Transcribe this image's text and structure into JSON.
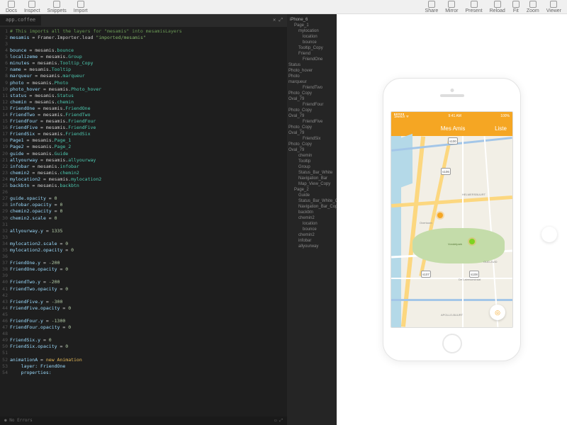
{
  "toolbar": {
    "left": [
      "Docs",
      "Inspect",
      "Snippets",
      "Import"
    ],
    "right": [
      "Share",
      "Mirror",
      "Present",
      "Reload",
      "Fit",
      "Zoom",
      "Viewer"
    ]
  },
  "editor": {
    "tab": "app.coffee",
    "status": "No Errors",
    "lines": [
      {
        "n": 1,
        "t": "cmt",
        "c": "# This imports all the layers for \"mesamis\" into mesamisLayers"
      },
      {
        "n": 2,
        "t": "assign",
        "lhs": "mesamis",
        "rhs": "Framer.Importer.load",
        "str": "\"imported/mesamis\""
      },
      {
        "n": 3,
        "t": "blank"
      },
      {
        "n": 4,
        "t": "assign",
        "lhs": "bounce",
        "rhs": "mesamis.",
        "prop": "bounce"
      },
      {
        "n": 5,
        "t": "assign",
        "lhs": "localizeme",
        "rhs": "mesamis.",
        "prop": "Group"
      },
      {
        "n": 6,
        "t": "assign",
        "lhs": "minutes",
        "rhs": "mesamis.",
        "prop": "Tooltip_Copy"
      },
      {
        "n": 7,
        "t": "assign",
        "lhs": "name",
        "rhs": "mesamis.",
        "prop": "Tooltip"
      },
      {
        "n": 8,
        "t": "assign",
        "lhs": "marqueur",
        "rhs": "mesamis.",
        "prop": "marqueur"
      },
      {
        "n": 9,
        "t": "assign",
        "lhs": "photo",
        "rhs": "mesamis.",
        "prop": "Photo"
      },
      {
        "n": 10,
        "t": "assign",
        "lhs": "photo_hover",
        "rhs": "mesamis.",
        "prop": "Photo_hover"
      },
      {
        "n": 11,
        "t": "assign",
        "lhs": "status",
        "rhs": "mesamis.",
        "prop": "Status"
      },
      {
        "n": 12,
        "t": "assign",
        "lhs": "chemin",
        "rhs": "mesamis.",
        "prop": "chemin"
      },
      {
        "n": 13,
        "t": "assign",
        "lhs": "FriendOne",
        "rhs": "mesamis.",
        "prop": "FriendOne"
      },
      {
        "n": 14,
        "t": "assign",
        "lhs": "FriendTwo",
        "rhs": "mesamis.",
        "prop": "FriendTwo"
      },
      {
        "n": 15,
        "t": "assign",
        "lhs": "FriendFour",
        "rhs": "mesamis.",
        "prop": "FriendFour"
      },
      {
        "n": 16,
        "t": "assign",
        "lhs": "FriendFive",
        "rhs": "mesamis.",
        "prop": "FriendFive"
      },
      {
        "n": 17,
        "t": "assign",
        "lhs": "FriendSix",
        "rhs": "mesamis.",
        "prop": "FriendSix"
      },
      {
        "n": 18,
        "t": "assign",
        "lhs": "Page1",
        "rhs": "mesamis.",
        "prop": "Page_1"
      },
      {
        "n": 19,
        "t": "assign",
        "lhs": "Page2",
        "rhs": "mesamis.",
        "prop": "Page_2"
      },
      {
        "n": 20,
        "t": "assign",
        "lhs": "guide",
        "rhs": "mesamis.",
        "prop": "Guide"
      },
      {
        "n": 21,
        "t": "assign",
        "lhs": "allyourway",
        "rhs": "mesamis.",
        "prop": "allyourway"
      },
      {
        "n": 22,
        "t": "assign",
        "lhs": "infobar",
        "rhs": "mesamis.",
        "prop": "infobar"
      },
      {
        "n": 23,
        "t": "assign",
        "lhs": "chemin2",
        "rhs": "mesamis.",
        "prop": "chemin2"
      },
      {
        "n": 24,
        "t": "assign",
        "lhs": "mylocation2",
        "rhs": "mesamis.",
        "prop": "mylocation2"
      },
      {
        "n": 25,
        "t": "assign",
        "lhs": "backbtn",
        "rhs": "mesamis.",
        "prop": "backbtn"
      },
      {
        "n": 26,
        "t": "blank"
      },
      {
        "n": 27,
        "t": "set",
        "lhs": "guide.opacity",
        "val": "0"
      },
      {
        "n": 28,
        "t": "set",
        "lhs": "infobar.opacity",
        "val": "0"
      },
      {
        "n": 29,
        "t": "set",
        "lhs": "chemin2.opacity",
        "val": "0"
      },
      {
        "n": 30,
        "t": "set",
        "lhs": "chemin2.scale",
        "val": "0"
      },
      {
        "n": 31,
        "t": "blank"
      },
      {
        "n": 32,
        "t": "set",
        "lhs": "allyourway.y",
        "val": "1335"
      },
      {
        "n": 33,
        "t": "blank"
      },
      {
        "n": 34,
        "t": "set",
        "lhs": "mylocation2.scale",
        "val": "0"
      },
      {
        "n": 35,
        "t": "set",
        "lhs": "mylocation2.opacity",
        "val": "0"
      },
      {
        "n": 36,
        "t": "blank"
      },
      {
        "n": 37,
        "t": "set",
        "lhs": "FriendOne.y",
        "val": "-200"
      },
      {
        "n": 38,
        "t": "set",
        "lhs": "FriendOne.opacity",
        "val": "0"
      },
      {
        "n": 39,
        "t": "blank"
      },
      {
        "n": 40,
        "t": "set",
        "lhs": "FriendTwo.y",
        "val": "-200"
      },
      {
        "n": 41,
        "t": "set",
        "lhs": "FriendTwo.opacity",
        "val": "0"
      },
      {
        "n": 42,
        "t": "blank"
      },
      {
        "n": 43,
        "t": "set",
        "lhs": "FriendFive.y",
        "val": "-300"
      },
      {
        "n": 44,
        "t": "set",
        "lhs": "FriendFive.opacity",
        "val": "0"
      },
      {
        "n": 45,
        "t": "blank"
      },
      {
        "n": 46,
        "t": "set",
        "lhs": "FriendFour.y",
        "val": "-1300"
      },
      {
        "n": 47,
        "t": "set",
        "lhs": "FriendFour.opacity",
        "val": "0"
      },
      {
        "n": 48,
        "t": "blank"
      },
      {
        "n": 49,
        "t": "set",
        "lhs": "FriendSix.y",
        "val": "0"
      },
      {
        "n": 50,
        "t": "set",
        "lhs": "FriendSix.opacity",
        "val": "0"
      },
      {
        "n": 51,
        "t": "blank"
      },
      {
        "n": 52,
        "t": "anim",
        "c": "animationA = new Animation"
      },
      {
        "n": 53,
        "t": "animp",
        "c": "    layer: FriendOne"
      },
      {
        "n": 54,
        "t": "animp",
        "c": "    properties:"
      }
    ]
  },
  "layers": {
    "root": "iPhone_6",
    "items": [
      {
        "l": 0,
        "t": "Page_1"
      },
      {
        "l": 1,
        "t": "mylocation"
      },
      {
        "l": 2,
        "t": "location"
      },
      {
        "l": 2,
        "t": "bounce"
      },
      {
        "l": 1,
        "t": "Tooltip_Copy"
      },
      {
        "l": 1,
        "t": "Friend"
      },
      {
        "l": 2,
        "t": "FriendOne"
      },
      {
        "l": 3,
        "t": "Status"
      },
      {
        "l": 3,
        "t": "Photo_hover"
      },
      {
        "l": 3,
        "t": "Photo"
      },
      {
        "l": 3,
        "t": "marqueur"
      },
      {
        "l": 2,
        "t": "FriendTwo"
      },
      {
        "l": 3,
        "t": "Photo_Copy"
      },
      {
        "l": 3,
        "t": "Oval_79"
      },
      {
        "l": 2,
        "t": "FriendFour"
      },
      {
        "l": 3,
        "t": "Photo_Copy"
      },
      {
        "l": 3,
        "t": "Oval_79"
      },
      {
        "l": 2,
        "t": "FriendFive"
      },
      {
        "l": 3,
        "t": "Photo_Copy"
      },
      {
        "l": 3,
        "t": "Oval_79"
      },
      {
        "l": 2,
        "t": "FriendSix"
      },
      {
        "l": 3,
        "t": "Photo_Copy"
      },
      {
        "l": 3,
        "t": "Oval_79"
      },
      {
        "l": 1,
        "t": "chemin"
      },
      {
        "l": 1,
        "t": "Tooltip"
      },
      {
        "l": 1,
        "t": "Group"
      },
      {
        "l": 1,
        "t": "Status_Bar_White"
      },
      {
        "l": 1,
        "t": "Navigation_Bar"
      },
      {
        "l": 1,
        "t": "Map_View_Copy"
      },
      {
        "l": 0,
        "t": "Page_2"
      },
      {
        "l": 1,
        "t": "Guide"
      },
      {
        "l": 1,
        "t": "Status_Bar_White_Copy"
      },
      {
        "l": 1,
        "t": "Navigation_Bar_Copy"
      },
      {
        "l": 1,
        "t": "backbtn"
      },
      {
        "l": 1,
        "t": "chemin2"
      },
      {
        "l": 2,
        "t": "location"
      },
      {
        "l": 2,
        "t": "bounce"
      },
      {
        "l": 1,
        "t": "chemin2"
      },
      {
        "l": 1,
        "t": "infobar"
      },
      {
        "l": 1,
        "t": "allyourway"
      }
    ]
  },
  "app": {
    "statusbar": {
      "carrier": "Sketch",
      "time": "9:41 AM",
      "battery": "100%"
    },
    "nav": {
      "title": "Mes Amis",
      "right": "Liste"
    },
    "shields": [
      "s100",
      "s106",
      "s107",
      "s108"
    ],
    "labels": [
      "HELMERSBUURT",
      "Overtoom",
      "Vondelpark",
      "OUD-ZUID",
      "De Lairessestraat",
      "APOLLO-BUURT"
    ]
  }
}
